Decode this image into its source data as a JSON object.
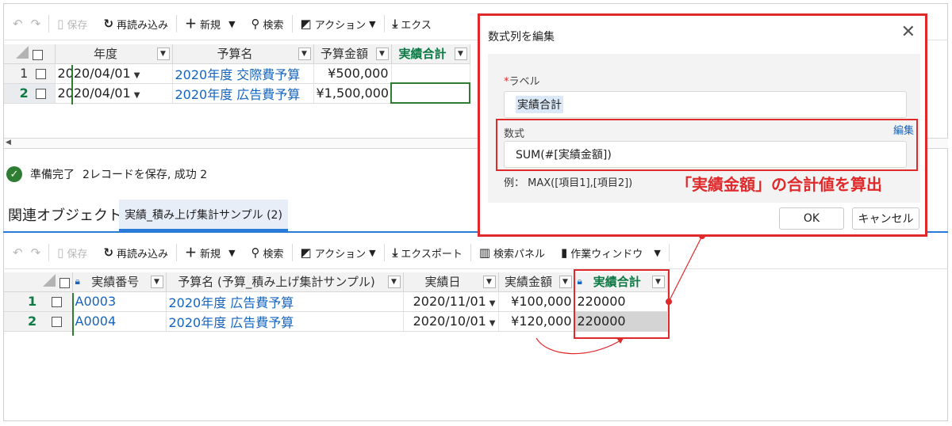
{
  "toolbar_top": {
    "undo": "↶",
    "redo": "↷",
    "save": "保存",
    "reload": "再読み込み",
    "new": "新規",
    "search": "検索",
    "action": "アクション",
    "export": "エクス"
  },
  "top_grid": {
    "headers": [
      "年度",
      "予算名",
      "予算金額",
      "実績合計"
    ],
    "rows": [
      {
        "num": "1",
        "year": "2020/04/01",
        "name": "2020年度 交際費予算",
        "amount": "¥500,000",
        "actual": ""
      },
      {
        "num": "2",
        "year": "2020/04/01",
        "name": "2020年度 広告費予算",
        "amount": "¥1,500,000",
        "actual": ""
      }
    ]
  },
  "status": {
    "text": "準備完了",
    "detail": "2レコードを保存, 成功 2"
  },
  "related": {
    "title": "関連オブジェクト",
    "tab": "実績_積み上げ集計サンプル (2)"
  },
  "toolbar_bottom": {
    "undo": "↶",
    "redo": "↷",
    "save": "保存",
    "reload": "再読み込み",
    "new": "新規",
    "search": "検索",
    "action": "アクション",
    "export": "エクスポート",
    "search_panel": "検索パネル",
    "work_window": "作業ウィンドウ"
  },
  "bottom_grid": {
    "headers": [
      "実績番号",
      "予算名 (予算_積み上げ集計サンプル)",
      "実績日",
      "実績金額",
      "実績合計"
    ],
    "rows": [
      {
        "num": "1",
        "id": "A0003",
        "name": "2020年度 広告費予算",
        "date": "2020/11/01",
        "amount": "¥100,000",
        "total": "220000"
      },
      {
        "num": "2",
        "id": "A0004",
        "name": "2020年度 広告費予算",
        "date": "2020/10/01",
        "amount": "¥120,000",
        "total": "220000"
      }
    ]
  },
  "dialog": {
    "title": "数式列を編集",
    "close": "✕",
    "label_caption": "ラベル",
    "label_required": "*",
    "label_value": "実績合計",
    "formula_caption": "数式",
    "formula_edit": "編集",
    "formula_value": "SUM(#[実績金額])",
    "example": "例： MAX([項目1],[項目2])",
    "ok": "OK",
    "cancel": "キャンセル"
  },
  "annotation": "「実績金額」の合計値を算出",
  "colors": {
    "accent_red": "#e0292b",
    "green_header": "#0b7a44",
    "link_blue": "#1565c0",
    "tab_blue": "#2a7ad8"
  }
}
